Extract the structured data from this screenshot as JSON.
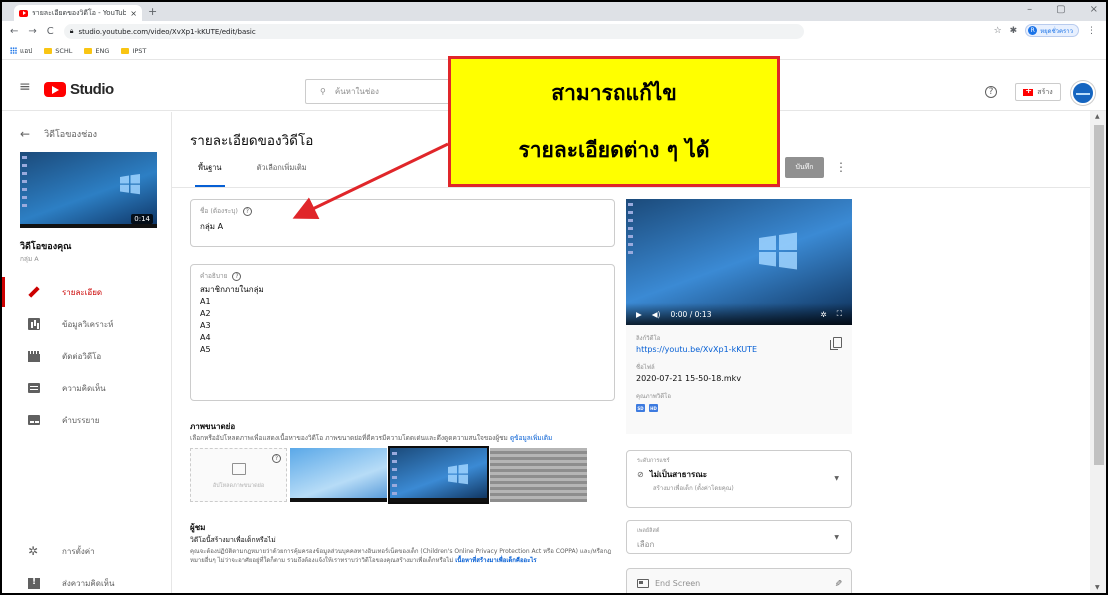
{
  "browser": {
    "tab_title": "รายละเอียดของวิดีโอ - YouTube Stu",
    "tab_close": "×",
    "new_tab": "+",
    "window_controls": [
      "–",
      "▢",
      "×"
    ],
    "url": "studio.youtube.com/video/XvXp1-kKUTE/edit/basic",
    "profile_label": "หยุดชั่วคราว",
    "profile_initial": "R",
    "bookmarks": [
      "แอป",
      "SCHL",
      "ENG",
      "IPST"
    ]
  },
  "header": {
    "logo_text": "Studio",
    "search_placeholder": "ค้นหาในช่อง",
    "create_label": "สร้าง"
  },
  "sidebar": {
    "back_label": "วิดีโอของช่อง",
    "thumb_duration": "0:14",
    "your_video": "วิดีโอของคุณ",
    "your_video_sub": "กลุ่ม A",
    "items": [
      {
        "label": "รายละเอียด",
        "icon": "pencil-icon",
        "active": true
      },
      {
        "label": "ข้อมูลวิเคราะห์",
        "icon": "analytics-icon",
        "active": false
      },
      {
        "label": "ตัดต่อวิดีโอ",
        "icon": "editor-icon",
        "active": false
      },
      {
        "label": "ความคิดเห็น",
        "icon": "comments-icon",
        "active": false
      },
      {
        "label": "คำบรรยาย",
        "icon": "subtitles-icon",
        "active": false
      }
    ],
    "settings_label": "การตั้งค่า",
    "feedback_label": "ส่งความคิดเห็น"
  },
  "main": {
    "page_title": "รายละเอียดของวิดีโอ",
    "tabs": [
      "พื้นฐาน",
      "ตัวเลือกเพิ่มเติม"
    ],
    "save_label": "บันทึก",
    "title_field": {
      "label": "ชื่อ (ต้องระบุ)",
      "value": "กลุ่ม A"
    },
    "description_field": {
      "label": "คำอธิบาย",
      "lines": [
        "สมาชิกภายในกลุ่ม",
        "A1",
        "A2",
        "A3",
        "A4",
        "A5"
      ]
    },
    "thumbnail": {
      "title": "ภาพขนาดย่อ",
      "description": "เลือกหรืออัปโหลดภาพเพื่อแสดงเนื้อหาของวิดีโอ ภาพขนาดย่อที่ดีควรมีความโดดเด่นและดึงดูดความสนใจของผู้ชม",
      "learn_more": "ดูข้อมูลเพิ่มเติม",
      "upload_label": "อัปโหลดภาพขนาดย่อ"
    },
    "audience": {
      "title": "ผู้ชม",
      "question": "วิดีโอนี้สร้างมาเพื่อเด็กหรือไม่",
      "text": "คุณจะต้องปฏิบัติตามกฎหมายว่าด้วยการคุ้มครองข้อมูลส่วนบุคคลทางอินเทอร์เน็ตของเด็ก (Children's Online Privacy Protection Act หรือ COPPA) และ/หรือกฎหมายอื่นๆ ไม่ว่าจะอาศัยอยู่ที่ใดก็ตาม รวมถึงต้องแจ้งให้เราทราบว่าวิดีโอของคุณสร้างมาเพื่อเด็กหรือไม่",
      "learn_more": "เนื้อหาที่สร้างมาเพื่อเด็กคืออะไร"
    }
  },
  "preview": {
    "time": "0:00 / 0:13",
    "link_label": "ลิงก์วิดีโอ",
    "link": "https://youtu.be/XvXp1-kKUTE",
    "filename_label": "ชื่อไฟล์",
    "filename": "2020-07-21 15-50-18.mkv",
    "quality_label": "คุณภาพวิดีโอ",
    "quality_badges": [
      "SD",
      "HD"
    ],
    "visibility_label": "ระดับการแชร์",
    "visibility_value": "ไม่เป็นสาธารณะ",
    "visibility_sub": "สร้างมาเพื่อเด็ก (ตั้งค่าโดยคุณ)",
    "playlist_label": "เพลย์ลิสต์",
    "playlist_value": "เลือก",
    "endscreen_label": "End Screen"
  },
  "callout": {
    "line1": "สามารถแก้ไข",
    "line2": "รายละเอียดต่าง ๆ ได้"
  },
  "colors": {
    "callout_bg": "#ffff00",
    "callout_border": "#e0262a",
    "accent_red": "#cc0000",
    "link_blue": "#065fd4",
    "tab_underline": "#065fd4"
  }
}
